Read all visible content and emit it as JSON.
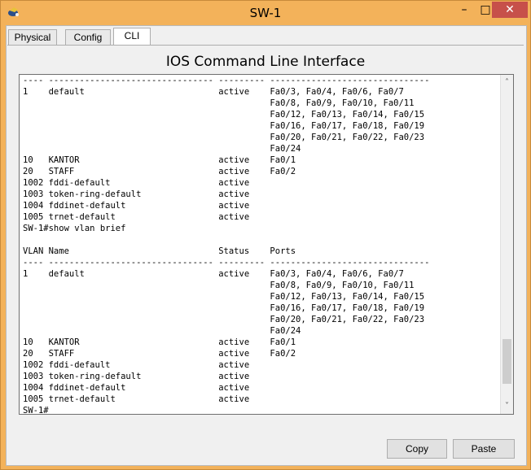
{
  "window": {
    "title": "SW-1",
    "controls": {
      "minimize": "–",
      "maximize": "□",
      "close": "✕"
    }
  },
  "tabs": [
    {
      "label": "Physical",
      "active": false
    },
    {
      "label": "Config",
      "active": false
    },
    {
      "label": "CLI",
      "active": true
    }
  ],
  "cli": {
    "heading": "IOS Command Line Interface",
    "lines": [
      "---- -------------------------------- --------- -------------------------------",
      "1    default                          active    Fa0/3, Fa0/4, Fa0/6, Fa0/7",
      "                                                Fa0/8, Fa0/9, Fa0/10, Fa0/11",
      "                                                Fa0/12, Fa0/13, Fa0/14, Fa0/15",
      "                                                Fa0/16, Fa0/17, Fa0/18, Fa0/19",
      "                                                Fa0/20, Fa0/21, Fa0/22, Fa0/23",
      "                                                Fa0/24",
      "10   KANTOR                           active    Fa0/1",
      "20   STAFF                            active    Fa0/2",
      "1002 fddi-default                     active",
      "1003 token-ring-default               active",
      "1004 fddinet-default                  active",
      "1005 trnet-default                    active",
      "SW-1#show vlan brief",
      "",
      "VLAN Name                             Status    Ports",
      "---- -------------------------------- --------- -------------------------------",
      "1    default                          active    Fa0/3, Fa0/4, Fa0/6, Fa0/7",
      "                                                Fa0/8, Fa0/9, Fa0/10, Fa0/11",
      "                                                Fa0/12, Fa0/13, Fa0/14, Fa0/15",
      "                                                Fa0/16, Fa0/17, Fa0/18, Fa0/19",
      "                                                Fa0/20, Fa0/21, Fa0/22, Fa0/23",
      "                                                Fa0/24",
      "10   KANTOR                           active    Fa0/1",
      "20   STAFF                            active    Fa0/2",
      "1002 fddi-default                     active",
      "1003 token-ring-default               active",
      "1004 fddinet-default                  active",
      "1005 trnet-default                    active",
      "SW-1#"
    ],
    "scroll_arrows": {
      "up": "˄",
      "down": "˅"
    }
  },
  "buttons": {
    "copy": "Copy",
    "paste": "Paste"
  }
}
